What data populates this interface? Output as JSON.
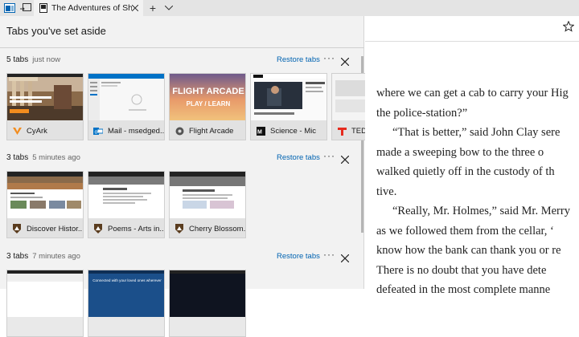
{
  "tabbar": {
    "active_tab_title": "The Adventures of Sher",
    "tab_favicon": "book-icon",
    "new_tab": "+",
    "tab_actions": [
      "tabs-aside-icon",
      "restore-aside-icon",
      "chevron-down-icon"
    ]
  },
  "panel": {
    "title": "Tabs you've set aside"
  },
  "groups": [
    {
      "count": "5 tabs",
      "time": "just now",
      "restore": "Restore tabs",
      "more": "···",
      "tabs": [
        {
          "label": "CyArk",
          "icon": "cyark-icon",
          "icon_color": "#f28c1e"
        },
        {
          "label": "Mail - msedged...",
          "icon": "mail-icon",
          "icon_color": "#0072c6"
        },
        {
          "label": "Flight Arcade",
          "icon": "flight-arcade-icon",
          "icon_color": "#555555",
          "thumb_text": [
            "FLIGHT ARCADE",
            "PLAY / LEARN"
          ]
        },
        {
          "label": "Science - Mic",
          "icon": "mic-icon",
          "icon_color": "#111111"
        },
        {
          "label": "TED",
          "icon": "ted-icon",
          "icon_color": "#e62b1e"
        }
      ]
    },
    {
      "count": "3 tabs",
      "time": "5 minutes ago",
      "restore": "Restore tabs",
      "more": "···",
      "tabs": [
        {
          "label": "Discover Histor...",
          "icon": "nps-icon",
          "icon_color": "#5a3c1e"
        },
        {
          "label": "Poems - Arts in...",
          "icon": "nps-icon",
          "icon_color": "#5a3c1e"
        },
        {
          "label": "Cherry Blossom...",
          "icon": "nps-icon",
          "icon_color": "#5a3c1e"
        }
      ]
    },
    {
      "count": "3 tabs",
      "time": "7 minutes ago",
      "restore": "Restore tabs",
      "more": "···",
      "tabs": [
        {
          "label": "",
          "icon": "",
          "icon_color": "#1b4f8a",
          "thumb_text": [
            "Connected with your loved ones wherever"
          ]
        },
        {
          "label": "",
          "icon": "",
          "icon_color": "#f0f0f0"
        },
        {
          "label": "",
          "icon": "",
          "icon_color": "#0f1420"
        }
      ]
    }
  ],
  "reader": {
    "star_icon": "favorite-star-icon",
    "lines": [
      "where we can get a cab to carry your Hig",
      "the police-station?”",
      "“That is better,” said John Clay sere",
      "made a sweeping bow to the three o",
      "walked quietly off in the custody of th",
      "tive.",
      "“Really, Mr. Holmes,” said Mr. Merry",
      "as we followed them from the cellar, ‘",
      "know how the bank can thank you or re",
      "There is no doubt that you have dete",
      "defeated in the most complete manne"
    ]
  }
}
